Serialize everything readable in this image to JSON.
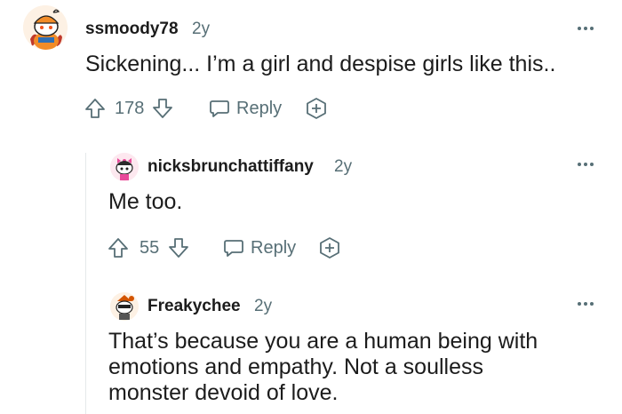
{
  "comments": [
    {
      "username": "ssmoody78",
      "age": "2y",
      "body": "Sickening... I’m a girl and despise girls like this..",
      "score": "178",
      "reply_label": "Reply"
    },
    {
      "username": "nicksbrunchattiffany",
      "age": "2y",
      "body": "Me too.",
      "score": "55",
      "reply_label": "Reply"
    },
    {
      "username": "Freakychee",
      "age": "2y",
      "body_lines": [
        "That’s because you are a human being with",
        "emotions and empathy. Not a soulless",
        "monster devoid of love."
      ]
    }
  ],
  "colors": {
    "text": "#1c1c1c",
    "meta": "#576f76",
    "thread_line": "#e5e9ea"
  },
  "icons": {
    "upvote": "arrow-up-icon",
    "downvote": "arrow-down-icon",
    "reply": "speech-bubble-icon",
    "award": "plus-circle-icon",
    "more": "more-horizontal-icon"
  }
}
